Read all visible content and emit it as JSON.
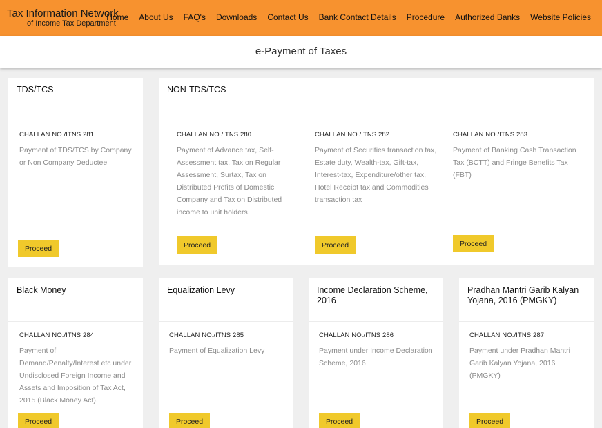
{
  "header": {
    "brand_title": "Tax Information Network",
    "brand_subtitle": "of Income Tax Department",
    "nav": [
      "Home",
      "About Us",
      "FAQ's",
      "Downloads",
      "Contact Us",
      "Bank Contact Details",
      "Procedure",
      "Authorized Banks",
      "Website Policies"
    ]
  },
  "page_title": "e-Payment of Taxes",
  "proceed_label": "Proceed",
  "cards": {
    "tds": {
      "title": "TDS/TCS",
      "challan": "CHALLAN NO./ITNS 281",
      "desc": "Payment of TDS/TCS by Company or Non Company Deductee"
    },
    "non_tds": {
      "title": "NON-TDS/TCS",
      "items": [
        {
          "challan": "CHALLAN NO./ITNS 280",
          "desc": "Payment of Advance tax, Self-Assessment tax, Tax on Regular Assessment, Surtax, Tax on Distributed Profits of Domestic Company and Tax on Distributed income to unit holders."
        },
        {
          "challan": "CHALLAN NO./ITNS 282",
          "desc": "Payment of Securities transaction tax, Estate duty, Wealth-tax, Gift-tax, Interest-tax, Expenditure/other tax, Hotel Receipt tax and Commodities transaction tax"
        },
        {
          "challan": "CHALLAN NO./ITNS 283",
          "desc": "Payment of Banking Cash Transaction Tax (BCTT) and Fringe Benefits Tax (FBT)"
        }
      ]
    },
    "black_money": {
      "title": "Black Money",
      "challan": "CHALLAN NO./ITNS 284",
      "desc": "Payment of Demand/Penalty/Interest etc under Undisclosed Foreign Income and Assets and Imposition of Tax Act, 2015 (Black Money Act)."
    },
    "equalization": {
      "title": "Equalization Levy",
      "challan": "CHALLAN NO./ITNS 285",
      "desc": "Payment of Equalization Levy"
    },
    "ids": {
      "title": "Income Declaration Scheme, 2016",
      "challan": "CHALLAN NO./ITNS 286",
      "desc": "Payment under Income Declaration Scheme, 2016"
    },
    "pmgky": {
      "title": "Pradhan Mantri Garib Kalyan Yojana, 2016 (PMGKY)",
      "challan": "CHALLAN NO./ITNS 287",
      "desc": "Payment under Pradhan Mantri Garib Kalyan Yojana, 2016 (PMGKY)"
    }
  }
}
